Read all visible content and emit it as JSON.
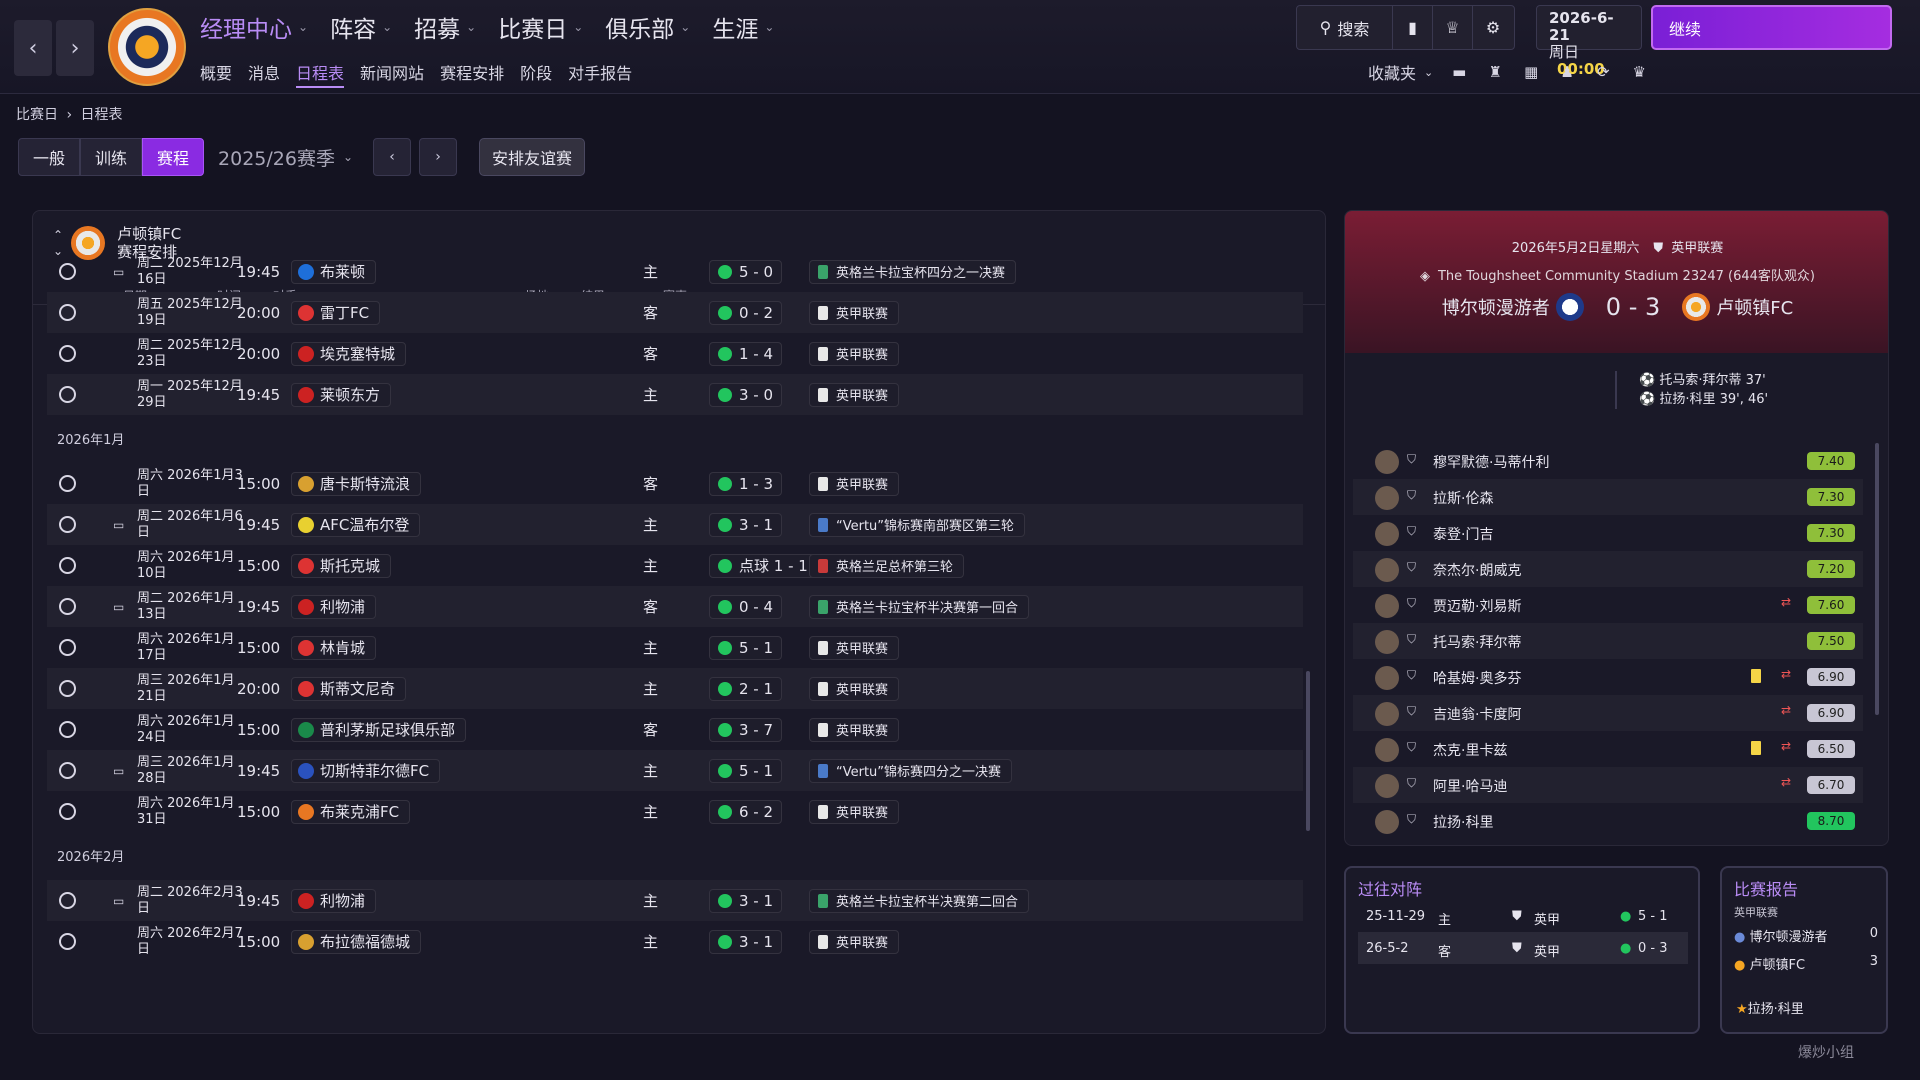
{
  "nav": {
    "back": "‹",
    "forward": "›",
    "menu": [
      "经理中心",
      "阵容",
      "招募",
      "比赛日",
      "俱乐部",
      "生涯"
    ],
    "submenu": [
      "概要",
      "消息",
      "日程表",
      "新闻网站",
      "赛程安排",
      "阶段",
      "对手报告"
    ]
  },
  "toolbar": {
    "search": "搜索",
    "date": "2026-6-21",
    "weekday": "周日",
    "time": "00:00",
    "continue": "继续",
    "favorites": "收藏夹"
  },
  "breadcrumb": {
    "a": "比赛日",
    "sep": "›",
    "b": "日程表"
  },
  "tabs": {
    "general": "一般",
    "training": "训练",
    "fixtures": "赛程",
    "season": "2025/26赛季",
    "friendly": "安排友谊赛"
  },
  "panel": {
    "club": "卢顿镇FC",
    "subtitle": "赛程安排",
    "headers": [
      "..",
      "..",
      "日期",
      "时间",
      "对手",
      "场地",
      "结果",
      "赛事"
    ]
  },
  "groups": [
    {
      "month": "",
      "rows": [
        {
          "tv": true,
          "date": "周二 2025年12月16日",
          "time": "19:45",
          "opp": "布莱顿",
          "opp_color": "#1e6fd9",
          "venue": "主",
          "result": "5 - 0",
          "comp": "英格兰卡拉宝杯四分之一决赛",
          "comp_color": "#3aa36a"
        },
        {
          "tv": false,
          "date": "周五 2025年12月19日",
          "time": "20:00",
          "opp": "雷丁FC",
          "opp_color": "#d33",
          "venue": "客",
          "result": "0 - 2",
          "comp": "英甲联赛",
          "comp_color": "#e8e8e8"
        },
        {
          "tv": false,
          "date": "周二 2025年12月23日",
          "time": "20:00",
          "opp": "埃克塞特城",
          "opp_color": "#c22",
          "venue": "客",
          "result": "1 - 4",
          "comp": "英甲联赛",
          "comp_color": "#e8e8e8"
        },
        {
          "tv": false,
          "date": "周一 2025年12月29日",
          "time": "19:45",
          "opp": "莱顿东方",
          "opp_color": "#c22",
          "venue": "主",
          "result": "3 - 0",
          "comp": "英甲联赛",
          "comp_color": "#e8e8e8"
        }
      ]
    },
    {
      "month": "2026年1月",
      "rows": [
        {
          "tv": false,
          "date": "周六 2026年1月3日",
          "time": "15:00",
          "opp": "唐卡斯特流浪",
          "opp_color": "#d8a030",
          "venue": "客",
          "result": "1 - 3",
          "comp": "英甲联赛",
          "comp_color": "#e8e8e8"
        },
        {
          "tv": true,
          "date": "周二 2026年1月6日",
          "time": "19:45",
          "opp": "AFC温布尔登",
          "opp_color": "#e8d030",
          "venue": "主",
          "result": "3 - 1",
          "comp": "“Vertu”锦标赛南部赛区第三轮",
          "comp_color": "#4a7ac8"
        },
        {
          "tv": false,
          "date": "周六 2026年1月10日",
          "time": "15:00",
          "opp": "斯托克城",
          "opp_color": "#d33",
          "venue": "主",
          "result": "点球 1 - 1",
          "comp": "英格兰足总杯第三轮",
          "comp_color": "#c83a3a"
        },
        {
          "tv": true,
          "date": "周二 2026年1月13日",
          "time": "19:45",
          "opp": "利物浦",
          "opp_color": "#c22",
          "venue": "客",
          "result": "0 - 4",
          "comp": "英格兰卡拉宝杯半决赛第一回合",
          "comp_color": "#3aa36a"
        },
        {
          "tv": false,
          "date": "周六 2026年1月17日",
          "time": "15:00",
          "opp": "林肯城",
          "opp_color": "#d33",
          "venue": "主",
          "result": "5 - 1",
          "comp": "英甲联赛",
          "comp_color": "#e8e8e8"
        },
        {
          "tv": false,
          "date": "周三 2026年1月21日",
          "time": "20:00",
          "opp": "斯蒂文尼奇",
          "opp_color": "#d33",
          "venue": "主",
          "result": "2 - 1",
          "comp": "英甲联赛",
          "comp_color": "#e8e8e8"
        },
        {
          "tv": false,
          "date": "周六 2026年1月24日",
          "time": "15:00",
          "opp": "普利茅斯足球俱乐部",
          "opp_color": "#1a8a4a",
          "venue": "客",
          "result": "3 - 7",
          "comp": "英甲联赛",
          "comp_color": "#e8e8e8"
        },
        {
          "tv": true,
          "date": "周三 2026年1月28日",
          "time": "19:45",
          "opp": "切斯特菲尔德FC",
          "opp_color": "#2a52be",
          "venue": "主",
          "result": "5 - 1",
          "comp": "“Vertu”锦标赛四分之一决赛",
          "comp_color": "#4a7ac8"
        },
        {
          "tv": false,
          "date": "周六 2026年1月31日",
          "time": "15:00",
          "opp": "布莱克浦FC",
          "opp_color": "#e87722",
          "venue": "主",
          "result": "6 - 2",
          "comp": "英甲联赛",
          "comp_color": "#e8e8e8"
        }
      ]
    },
    {
      "month": "2026年2月",
      "rows": [
        {
          "tv": true,
          "date": "周二 2026年2月3日",
          "time": "19:45",
          "opp": "利物浦",
          "opp_color": "#c22",
          "venue": "主",
          "result": "3 - 1",
          "comp": "英格兰卡拉宝杯半决赛第二回合",
          "comp_color": "#3aa36a"
        },
        {
          "tv": false,
          "date": "周六 2026年2月7日",
          "time": "15:00",
          "opp": "布拉德福德城",
          "opp_color": "#d8a030",
          "venue": "主",
          "result": "3 - 1",
          "comp": "英甲联赛",
          "comp_color": "#e8e8e8"
        }
      ]
    }
  ],
  "match": {
    "date": "2026年5月2日星期六",
    "league": "英甲联赛",
    "stadium": "The Toughsheet Community Stadium",
    "attendance": "23247",
    "away_fans": "(644客队观众)",
    "home": "博尔顿漫游者",
    "score": "0 - 3",
    "away": "卢顿镇FC",
    "scorers": [
      "托马索·拜尔蒂 37'",
      "拉扬·科里 39', 46'"
    ],
    "players": [
      {
        "name": "穆罕默德·马蒂什利",
        "rating": "7.40",
        "rating_color": "#8fbf3a",
        "sub": false,
        "yellow": false
      },
      {
        "name": "拉斯·伦森",
        "rating": "7.30",
        "rating_color": "#8fbf3a",
        "sub": false,
        "yellow": false
      },
      {
        "name": "泰登·门吉",
        "rating": "7.30",
        "rating_color": "#8fbf3a",
        "sub": false,
        "yellow": false
      },
      {
        "name": "奈杰尔·朗威克",
        "rating": "7.20",
        "rating_color": "#8fbf3a",
        "sub": false,
        "yellow": false
      },
      {
        "name": "贾迈勒·刘易斯",
        "rating": "7.60",
        "rating_color": "#8fbf3a",
        "sub": true,
        "yellow": false
      },
      {
        "name": "托马索·拜尔蒂",
        "rating": "7.50",
        "rating_color": "#8fbf3a",
        "sub": false,
        "yellow": false
      },
      {
        "name": "哈基姆·奥多芬",
        "rating": "6.90",
        "rating_color": "#c8c6d4",
        "sub": true,
        "yellow": true
      },
      {
        "name": "吉迪翁·卡度阿",
        "rating": "6.90",
        "rating_color": "#c8c6d4",
        "sub": true,
        "yellow": false
      },
      {
        "name": "杰克·里卡兹",
        "rating": "6.50",
        "rating_color": "#c8c6d4",
        "sub": true,
        "yellow": true
      },
      {
        "name": "阿里·哈马迪",
        "rating": "6.70",
        "rating_color": "#c8c6d4",
        "sub": true,
        "yellow": false
      },
      {
        "name": "拉扬·科里",
        "rating": "8.70",
        "rating_color": "#22c55e",
        "sub": false,
        "yellow": false
      }
    ]
  },
  "h2h": {
    "title": "过往对阵",
    "rows": [
      {
        "date": "25-11-29",
        "venue": "主",
        "comp": "英甲",
        "result": "5 - 1"
      },
      {
        "date": "26-5-2",
        "venue": "客",
        "comp": "英甲",
        "result": "0 - 3"
      }
    ]
  },
  "report": {
    "title": "比赛报告",
    "league": "英甲联赛",
    "teams": [
      {
        "name": "博尔顿漫游者",
        "goals": "0"
      },
      {
        "name": "卢顿镇FC",
        "goals": "3"
      }
    ],
    "mvp": "拉扬·科里"
  },
  "watermark": "爆炒小组"
}
